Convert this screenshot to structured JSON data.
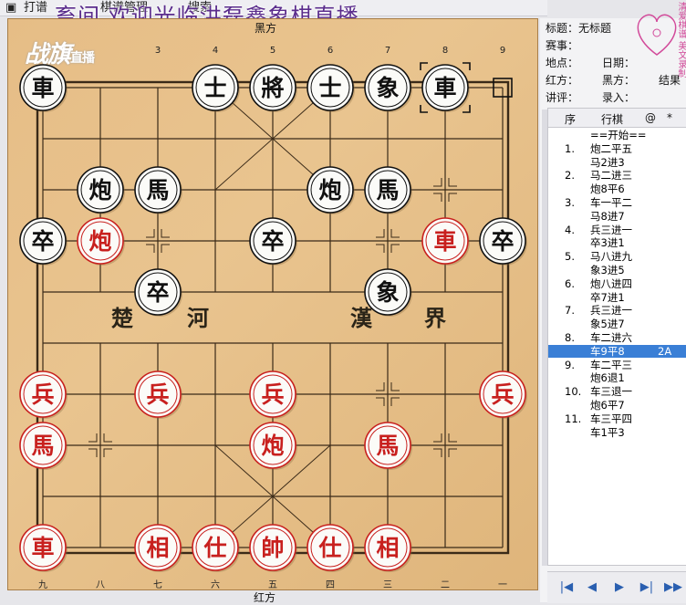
{
  "menu": {
    "items": [
      "打谱",
      "棋谱管理",
      "搜索"
    ]
  },
  "marquee": "畜间 欢迎光临洪磊鑫象棋直播",
  "logo": {
    "main": "战旗",
    "sub": "直播"
  },
  "board": {
    "top_label": "黑方",
    "bottom_label": "红方",
    "top_numbers": [
      "3",
      "4",
      "5",
      "6",
      "7",
      "8",
      "9"
    ],
    "bottom_numbers": [
      "九",
      "八",
      "七",
      "六",
      "五",
      "四",
      "三",
      "二",
      "一"
    ],
    "river_left": [
      "楚",
      "河"
    ],
    "river_right": [
      "漢",
      "界"
    ],
    "pieces": [
      {
        "t": "車",
        "s": "b",
        "c": 0,
        "r": 0
      },
      {
        "t": "士",
        "s": "b",
        "c": 3,
        "r": 0
      },
      {
        "t": "將",
        "s": "b",
        "c": 4,
        "r": 0
      },
      {
        "t": "士",
        "s": "b",
        "c": 5,
        "r": 0
      },
      {
        "t": "象",
        "s": "b",
        "c": 6,
        "r": 0
      },
      {
        "t": "車",
        "s": "b",
        "c": 7,
        "r": 0
      },
      {
        "t": "炮",
        "s": "b",
        "c": 1,
        "r": 2
      },
      {
        "t": "馬",
        "s": "b",
        "c": 2,
        "r": 2
      },
      {
        "t": "炮",
        "s": "b",
        "c": 5,
        "r": 2
      },
      {
        "t": "馬",
        "s": "b",
        "c": 6,
        "r": 2
      },
      {
        "t": "卒",
        "s": "b",
        "c": 0,
        "r": 3
      },
      {
        "t": "炮",
        "s": "r",
        "c": 1,
        "r": 3
      },
      {
        "t": "卒",
        "s": "b",
        "c": 4,
        "r": 3
      },
      {
        "t": "車",
        "s": "r",
        "c": 7,
        "r": 3
      },
      {
        "t": "卒",
        "s": "b",
        "c": 8,
        "r": 3
      },
      {
        "t": "卒",
        "s": "b",
        "c": 2,
        "r": 4
      },
      {
        "t": "象",
        "s": "b",
        "c": 6,
        "r": 4
      },
      {
        "t": "兵",
        "s": "r",
        "c": 0,
        "r": 6
      },
      {
        "t": "兵",
        "s": "r",
        "c": 2,
        "r": 6
      },
      {
        "t": "兵",
        "s": "r",
        "c": 4,
        "r": 6
      },
      {
        "t": "兵",
        "s": "r",
        "c": 8,
        "r": 6
      },
      {
        "t": "馬",
        "s": "r",
        "c": 0,
        "r": 7
      },
      {
        "t": "炮",
        "s": "r",
        "c": 4,
        "r": 7
      },
      {
        "t": "馬",
        "s": "r",
        "c": 6,
        "r": 7
      },
      {
        "t": "車",
        "s": "r",
        "c": 0,
        "r": 9
      },
      {
        "t": "相",
        "s": "r",
        "c": 2,
        "r": 9
      },
      {
        "t": "仕",
        "s": "r",
        "c": 3,
        "r": 9
      },
      {
        "t": "帥",
        "s": "r",
        "c": 4,
        "r": 9
      },
      {
        "t": "仕",
        "s": "r",
        "c": 5,
        "r": 9
      },
      {
        "t": "相",
        "s": "r",
        "c": 6,
        "r": 9
      }
    ]
  },
  "info": {
    "title": "标题：无标题",
    "event": "赛事：",
    "place": "地点：",
    "date": "日期：",
    "red": "红方：",
    "black": "黑方：",
    "result": "结果",
    "comment": "讲评：",
    "recorder": "录入："
  },
  "seal_text": "清爱棋谱 美文录制",
  "moves": {
    "headers": [
      "序",
      "行棋",
      "@",
      "*"
    ],
    "start": "==开始==",
    "rows": [
      {
        "no": "1.",
        "a": "炮二平五",
        "b": "马2进3"
      },
      {
        "no": "2.",
        "a": "马二进三",
        "b": "炮8平6"
      },
      {
        "no": "3.",
        "a": "车一平二",
        "b": "马8进7"
      },
      {
        "no": "4.",
        "a": "兵三进一",
        "b": "卒3进1"
      },
      {
        "no": "5.",
        "a": "马八进九",
        "b": "象3进5"
      },
      {
        "no": "6.",
        "a": "炮八进四",
        "b": "卒7进1"
      },
      {
        "no": "7.",
        "a": "兵三进一",
        "b": "象5进7"
      },
      {
        "no": "8.",
        "a": "车二进六",
        "b": "车9平8",
        "sel": "2A"
      },
      {
        "no": "9.",
        "a": "车二平三",
        "b": "炮6退1"
      },
      {
        "no": "10.",
        "a": "车三退一",
        "b": "炮6平7"
      },
      {
        "no": "11.",
        "a": "车三平四",
        "b": "车1平3"
      }
    ]
  },
  "nav": [
    "|◀",
    "◀",
    "▶",
    "▶|",
    "▶▶"
  ]
}
